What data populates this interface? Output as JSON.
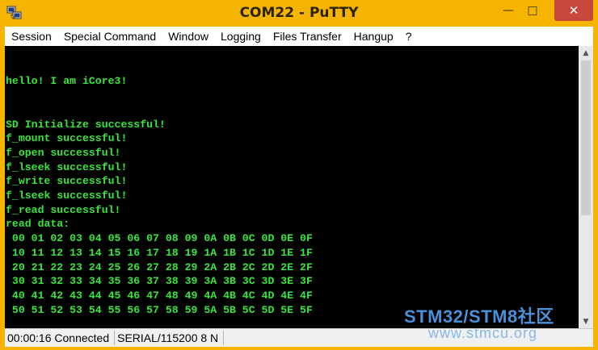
{
  "window": {
    "title": "COM22 - PuTTY"
  },
  "menu": [
    "Session",
    "Special Command",
    "Window",
    "Logging",
    "Files Transfer",
    "Hangup",
    "?"
  ],
  "terminal": {
    "lines": [
      "",
      "",
      "hello! I am iCore3!",
      "",
      "",
      "SD Initialize successful!",
      "f_mount successful!",
      "f_open successful!",
      "f_lseek successful!",
      "f_write successful!",
      "f_lseek successful!",
      "f_read successful!",
      "read data:",
      " 00 01 02 03 04 05 06 07 08 09 0A 0B 0C 0D 0E 0F",
      " 10 11 12 13 14 15 16 17 18 19 1A 1B 1C 1D 1E 1F",
      " 20 21 22 23 24 25 26 27 28 29 2A 2B 2C 2D 2E 2F",
      " 30 31 32 33 34 35 36 37 38 39 3A 3B 3C 3D 3E 3F",
      " 40 41 42 43 44 45 46 47 48 49 4A 4B 4C 4D 4E 4F",
      " 50 51 52 53 54 55 56 57 58 59 5A 5B 5C 5D 5E 5F"
    ],
    "text_color": "#39e63c",
    "background": "#000000"
  },
  "status": {
    "connection": "00:00:16 Connected",
    "port": "SERIAL/115200 8 N"
  },
  "watermark": {
    "top": "STM32/STM8社区",
    "bottom": "www.stmcu.org"
  },
  "icons": {
    "app": "putty-icon",
    "minimize": "minimize-icon",
    "maximize": "maximize-icon",
    "close": "close-icon"
  },
  "colors": {
    "titlebar": "#f5b400",
    "close_button": "#c9473c"
  }
}
